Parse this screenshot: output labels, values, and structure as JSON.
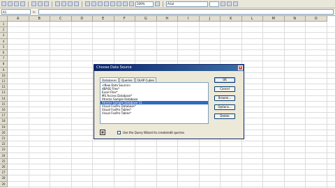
{
  "toolbar": {
    "zoom": "100%",
    "font": "Arial"
  },
  "formula_bar": {
    "name_box": "A1",
    "fx_label": "fx"
  },
  "sheet": {
    "columns": [
      "A",
      "B",
      "C",
      "D",
      "E",
      "F",
      "G",
      "H",
      "I",
      "J",
      "K",
      "L",
      "M",
      "N",
      "O"
    ],
    "rows": [
      "1",
      "2",
      "3",
      "4",
      "5",
      "6",
      "7",
      "8",
      "9",
      "10",
      "11",
      "12",
      "13",
      "14",
      "15",
      "16",
      "17",
      "18",
      "19",
      "20",
      "21",
      "22",
      "23",
      "24",
      "25",
      "26",
      "27",
      "28",
      "29"
    ]
  },
  "dialog": {
    "title": "Choose Data Source",
    "close_label": "x",
    "tabs": [
      "Databases",
      "Queries",
      "OLAP Cubes"
    ],
    "list_items": [
      "<New Data Source>",
      "dBASE Files*",
      "Excel Files*",
      "MS Access Database*",
      "Xtreme Sample Database",
      "Xtreme Sample Database 11",
      "Visual FoxPro Database*",
      "Visual FoxPro Tables*",
      "Visual FoxPro Tables*"
    ],
    "selected_index": 5,
    "buttons": [
      "OK",
      "Cancel",
      "Browse...",
      "Options...",
      "Delete"
    ],
    "checkbox_label": "Use the Query Wizard to create/edit queries",
    "checkbox_checked": false
  }
}
